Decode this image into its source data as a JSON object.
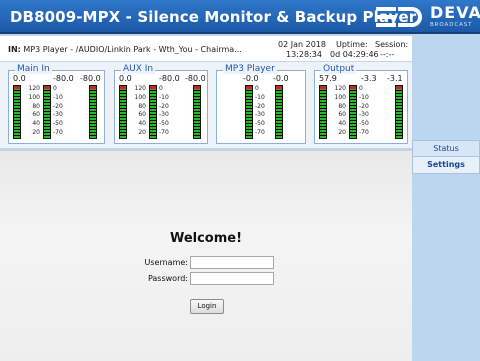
{
  "header": {
    "title": "DB8009-MPX - Silence Monitor & Backup Player",
    "logo_text": "DEVA",
    "logo_sub": "BROADCAST"
  },
  "info": {
    "input_label": "IN:",
    "now_playing": " MP3 Player - /AUDIO/Linkin Park - Wth_You - Chairma...",
    "date": "02 Jan 2018",
    "time": "13:28:34",
    "uptime_label": "Uptime:",
    "uptime_value": "0d 04:29:46",
    "session_label": "Session:",
    "session_value": "--:--"
  },
  "meters": {
    "scale_left": [
      "120",
      "100",
      "80",
      "60",
      "40",
      "20"
    ],
    "scale_right": [
      "0",
      "-10",
      "-20",
      "-30",
      "-50",
      "-70"
    ],
    "groups": [
      {
        "label": "Main In",
        "values": [
          "0.0",
          "-80.0",
          "-80.0"
        ],
        "levels": [
          1.0,
          1.0,
          1.0
        ]
      },
      {
        "label": "AUX In",
        "values": [
          "0.0",
          "-80.0",
          "-80.0"
        ],
        "levels": [
          1.0,
          1.0,
          1.0
        ]
      },
      {
        "label": "MP3 Player",
        "values": [
          "-0.0",
          "-0.0"
        ],
        "levels": [
          1.0,
          1.0
        ]
      },
      {
        "label": "Output",
        "values": [
          "57.9",
          "-3.3",
          "-3.1"
        ],
        "levels": [
          1.0,
          1.0,
          1.0
        ]
      }
    ]
  },
  "tabs": {
    "status": "Status",
    "settings": "Settings"
  },
  "login": {
    "welcome": "Welcome!",
    "username_label": "Username:",
    "password_label": "Password:",
    "button_label": "Login"
  },
  "colors": {
    "header_blue": "#2f77c8",
    "label_blue": "#1f58b5",
    "meter_green": "#27b927",
    "meter_red": "#d12020"
  }
}
